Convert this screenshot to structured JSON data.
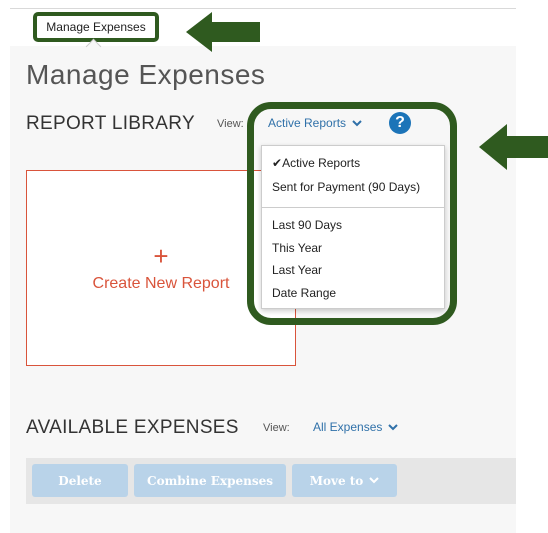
{
  "tab": {
    "label": "Manage Expenses"
  },
  "page_title": "Manage Expenses",
  "report_library": {
    "title": "REPORT LIBRARY",
    "view_label": "View:",
    "view_value": "Active Reports",
    "help": "?"
  },
  "create_card": {
    "plus": "+",
    "label": "Create New Report"
  },
  "dropdown": {
    "check": "✔",
    "items": [
      "Active Reports",
      "Sent for Payment (90 Days)",
      "Last 90 Days",
      "This Year",
      "Last Year",
      "Date Range"
    ]
  },
  "available_expenses": {
    "title": "AVAILABLE EXPENSES",
    "view_label": "View:",
    "view_value": "All Expenses"
  },
  "toolbar": {
    "delete": "Delete",
    "combine": "Combine Expenses",
    "move_to": "Move to"
  },
  "colors": {
    "annotation_green": "#2f5a1f",
    "link_blue": "#3071a9",
    "create_red": "#d9543b",
    "button_disabled": "#b9d3e9"
  }
}
